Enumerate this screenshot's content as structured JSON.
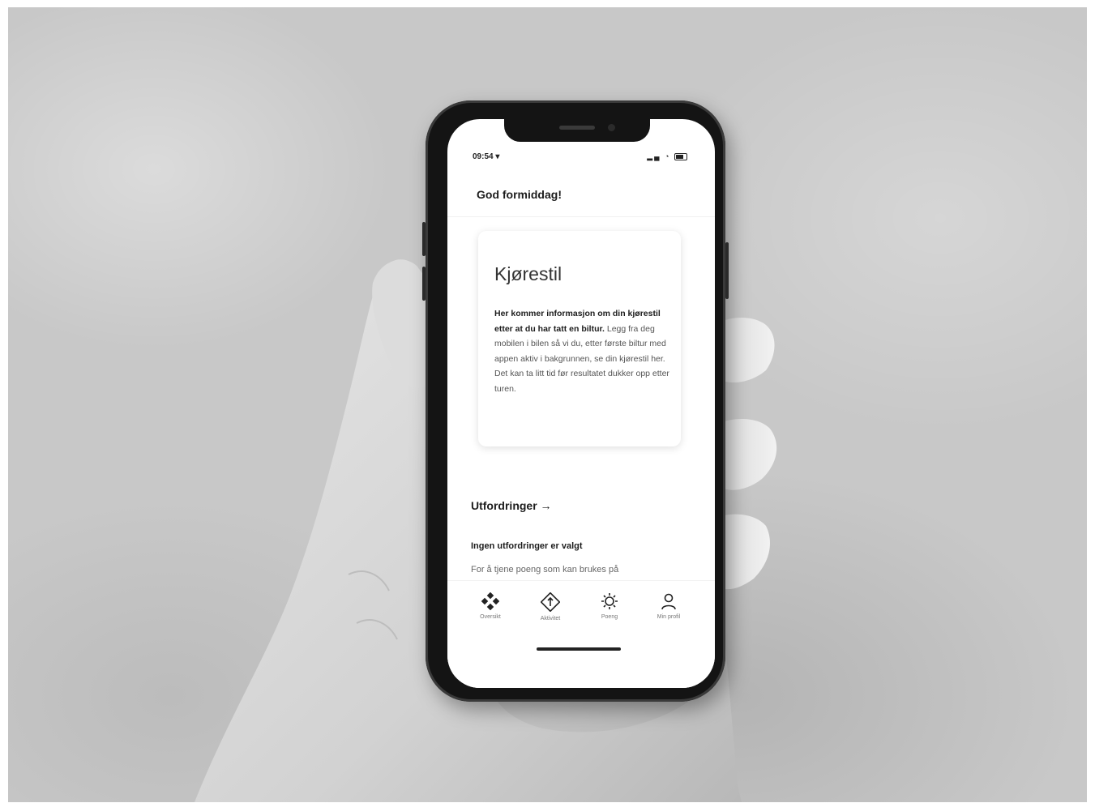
{
  "status_bar": {
    "time": "09:54 ▾",
    "icons_text": "..."
  },
  "header": {
    "greeting": "God formiddag!"
  },
  "card": {
    "title": "Kjørestil",
    "body_bold": "Her kommer informasjon om din kjørestil etter at du har tatt en biltur.",
    "body_text": "Legg fra deg mobilen i bilen så vi du, etter første biltur med appen aktiv i bakgrunnen, se din kjørestil her. Det kan ta litt tid før resultatet dukker opp etter turen."
  },
  "challenges": {
    "link_label": "Utfordringer →",
    "empty_title": "Ingen utfordringer er valgt",
    "empty_text": "For å tjene poeng som kan brukes på"
  },
  "tabbar": {
    "tabs": [
      {
        "label": "Oversikt",
        "icon": "overview-icon"
      },
      {
        "label": "Aktivitet",
        "icon": "activity-icon"
      },
      {
        "label": "Poeng",
        "icon": "points-icon"
      },
      {
        "label": "Min profil",
        "icon": "profile-icon"
      }
    ]
  },
  "colors": {
    "background": "#c8c8c8",
    "phone_frame": "#141414",
    "screen": "#ffffff",
    "text_primary": "#1c1c1c"
  }
}
